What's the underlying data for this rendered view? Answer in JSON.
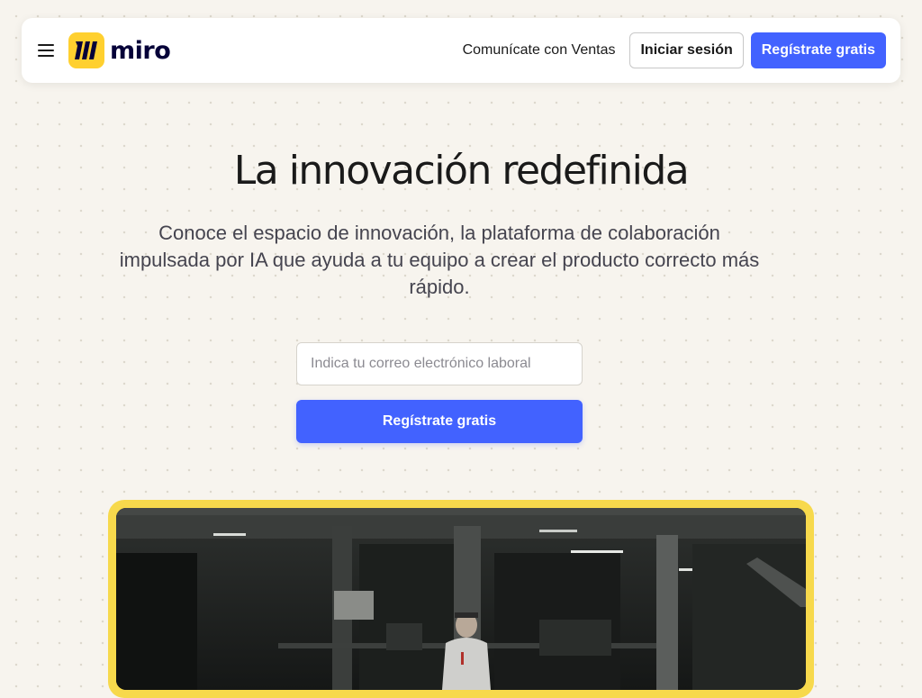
{
  "nav": {
    "menu_icon": "hamburger-menu-icon",
    "logo_icon": "miro-logo-mark-icon",
    "logo_text": "miro",
    "contact_sales": "Comunícate con Ventas",
    "login": "Iniciar sesión",
    "signup": "Regístrate gratis"
  },
  "hero": {
    "title": "La innovación redefinida",
    "subtitle": "Conoce el espacio de innovación, la plataforma de colaboración impulsada por IA que ayuda a tu equipo a crear el producto correcto más rápido.",
    "email_placeholder": "Indica tu correo electrónico laboral",
    "email_value": "",
    "cta": "Regístrate gratis"
  },
  "colors": {
    "accent": "#4262ff",
    "brand_yellow": "#ffd02f",
    "frame_yellow": "#f7d94c",
    "background": "#f7f4ee"
  }
}
